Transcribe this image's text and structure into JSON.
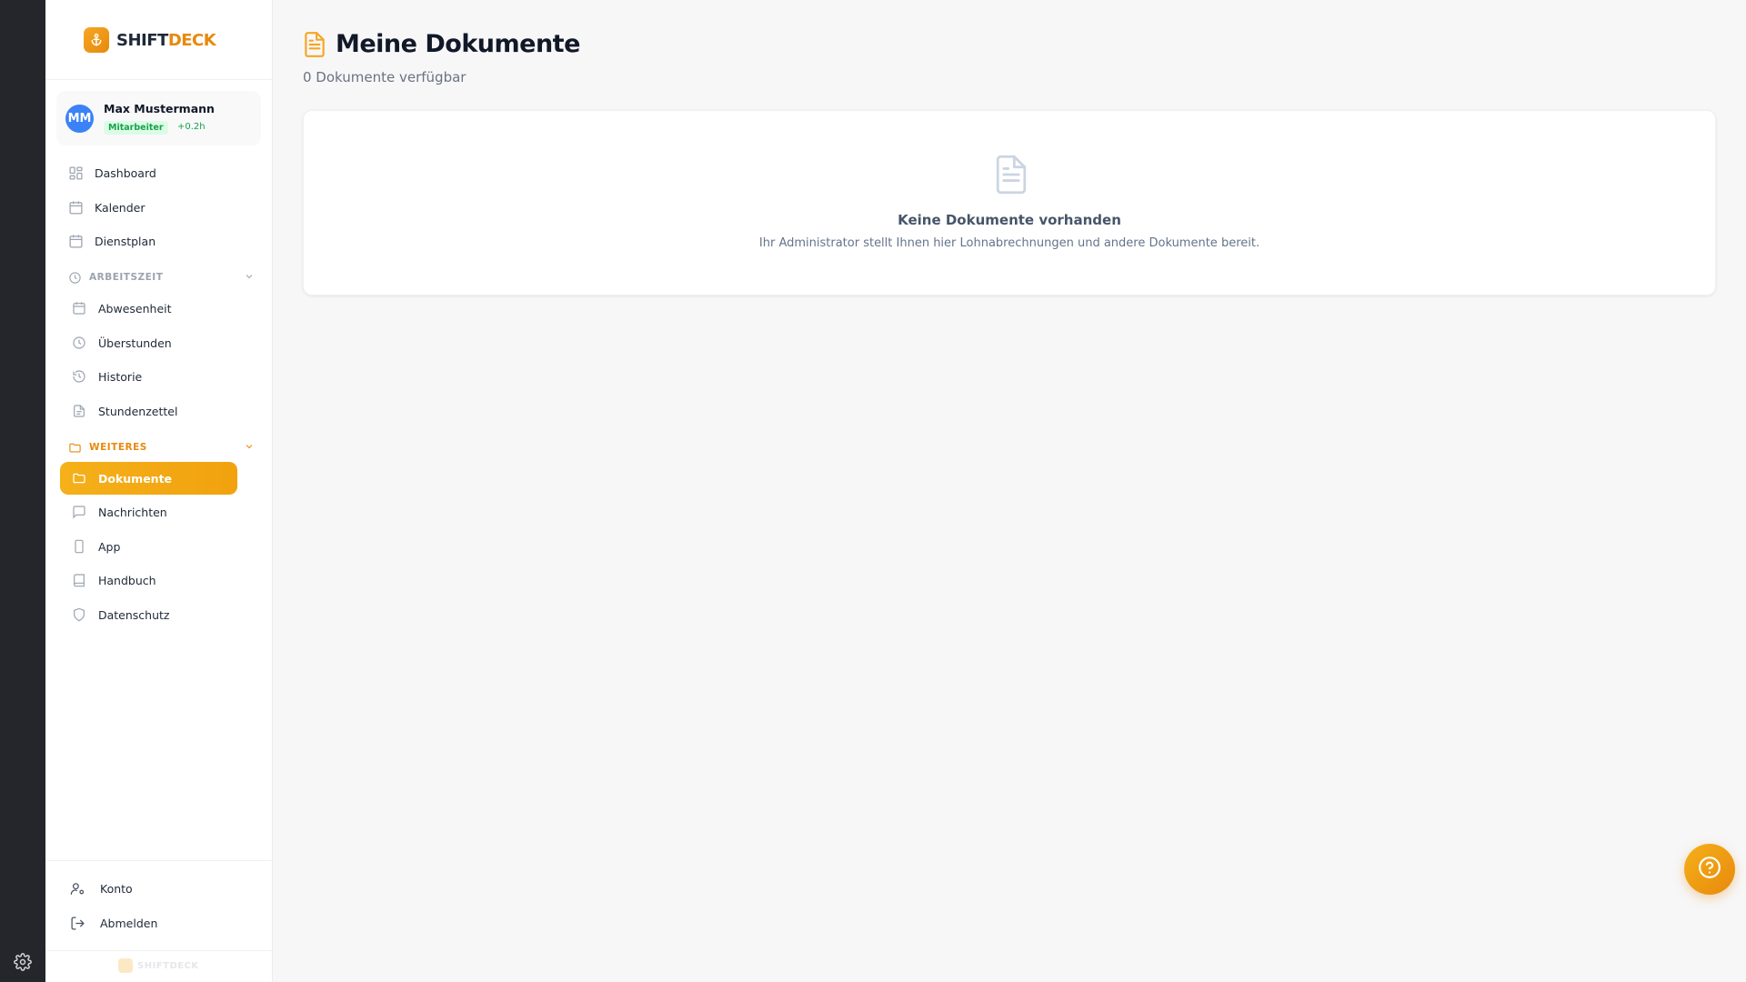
{
  "brand": {
    "name_a": "SHIFT",
    "name_b": "DECK",
    "footer": "SHIFTDECK"
  },
  "user": {
    "initials": "MM",
    "name": "Max Mustermann",
    "role": "Mitarbeiter",
    "hours": "+0.2h"
  },
  "nav": {
    "dashboard": "Dashboard",
    "kalender": "Kalender",
    "dienstplan": "Dienstplan",
    "section_arbeitszeit": "ARBEITSZEIT",
    "abwesenheit": "Abwesenheit",
    "ueberstunden": "Überstunden",
    "historie": "Historie",
    "stundenzettel": "Stundenzettel",
    "section_weiteres": "WEITERES",
    "dokumente": "Dokumente",
    "nachrichten": "Nachrichten",
    "app": "App",
    "handbuch": "Handbuch",
    "datenschutz": "Datenschutz",
    "konto": "Konto",
    "abmelden": "Abmelden"
  },
  "main": {
    "title": "Meine Dokumente",
    "subtitle": "0 Dokumente verfügbar",
    "empty_title": "Keine Dokumente vorhanden",
    "empty_desc": "Ihr Administrator stellt Ihnen hier Lohnabrechnungen und andere Dokumente bereit."
  },
  "colors": {
    "accent": "#f5a623",
    "accent_dark": "#e8890c",
    "rail": "#25252c",
    "avatar": "#3b82f6"
  },
  "icons": [
    "settings-gear-icon",
    "anchor-logo-icon",
    "dashboard-grid-icon",
    "calendar-icon",
    "clock-icon",
    "history-icon",
    "file-text-icon",
    "folder-icon",
    "message-icon",
    "smartphone-icon",
    "book-icon",
    "shield-icon",
    "user-cog-icon",
    "logout-icon",
    "help-circle-icon"
  ]
}
